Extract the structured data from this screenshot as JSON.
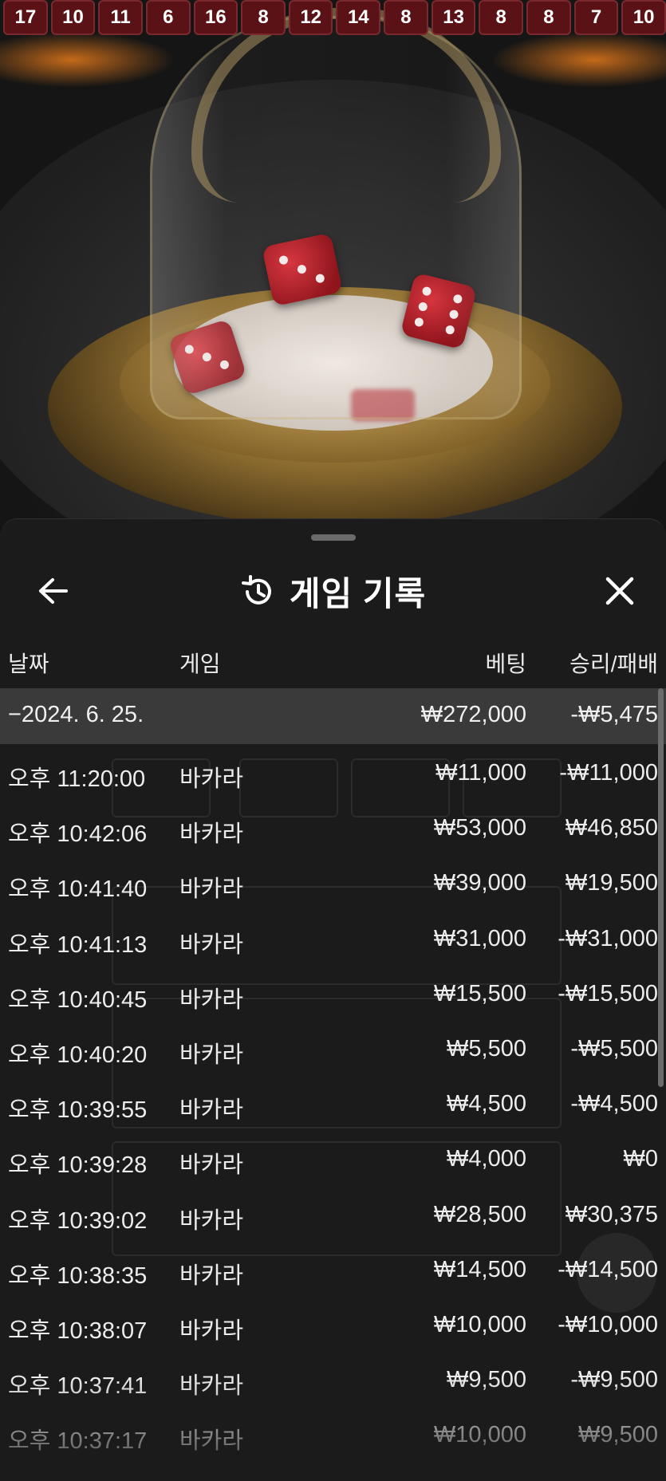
{
  "results": [
    "17",
    "10",
    "11",
    "6",
    "16",
    "8",
    "12",
    "14",
    "8",
    "13",
    "8",
    "8",
    "7",
    "10"
  ],
  "sheet": {
    "title": "게임 기록",
    "columns": {
      "date": "날짜",
      "game": "게임",
      "bet": "베팅",
      "win_loss": "승리/패배"
    },
    "day": {
      "date": "−2024. 6. 25.",
      "bet": "₩272,000",
      "win_loss": "-₩5,475"
    },
    "rows": [
      {
        "time": "오후 11:20:00",
        "game": "바카라",
        "bet": "₩11,000",
        "win_loss": "-₩11,000"
      },
      {
        "time": "오후 10:42:06",
        "game": "바카라",
        "bet": "₩53,000",
        "win_loss": "₩46,850"
      },
      {
        "time": "오후 10:41:40",
        "game": "바카라",
        "bet": "₩39,000",
        "win_loss": "₩19,500"
      },
      {
        "time": "오후 10:41:13",
        "game": "바카라",
        "bet": "₩31,000",
        "win_loss": "-₩31,000"
      },
      {
        "time": "오후 10:40:45",
        "game": "바카라",
        "bet": "₩15,500",
        "win_loss": "-₩15,500"
      },
      {
        "time": "오후 10:40:20",
        "game": "바카라",
        "bet": "₩5,500",
        "win_loss": "-₩5,500"
      },
      {
        "time": "오후 10:39:55",
        "game": "바카라",
        "bet": "₩4,500",
        "win_loss": "-₩4,500"
      },
      {
        "time": "오후 10:39:28",
        "game": "바카라",
        "bet": "₩4,000",
        "win_loss": "₩0"
      },
      {
        "time": "오후 10:39:02",
        "game": "바카라",
        "bet": "₩28,500",
        "win_loss": "₩30,375"
      },
      {
        "time": "오후 10:38:35",
        "game": "바카라",
        "bet": "₩14,500",
        "win_loss": "-₩14,500"
      },
      {
        "time": "오후 10:38:07",
        "game": "바카라",
        "bet": "₩10,000",
        "win_loss": "-₩10,000"
      },
      {
        "time": "오후 10:37:41",
        "game": "바카라",
        "bet": "₩9,500",
        "win_loss": "-₩9,500"
      },
      {
        "time": "오후 10:37:17",
        "game": "바카라",
        "bet": "₩10,000",
        "win_loss": "₩9,500"
      }
    ]
  },
  "icons": {
    "back": "arrow-left-icon",
    "history": "history-icon",
    "close": "close-icon"
  },
  "colors": {
    "sheet_bg": "#1b1b1b",
    "day_row_bg": "#3a3a3a",
    "chip_bg": "#5a1217"
  }
}
